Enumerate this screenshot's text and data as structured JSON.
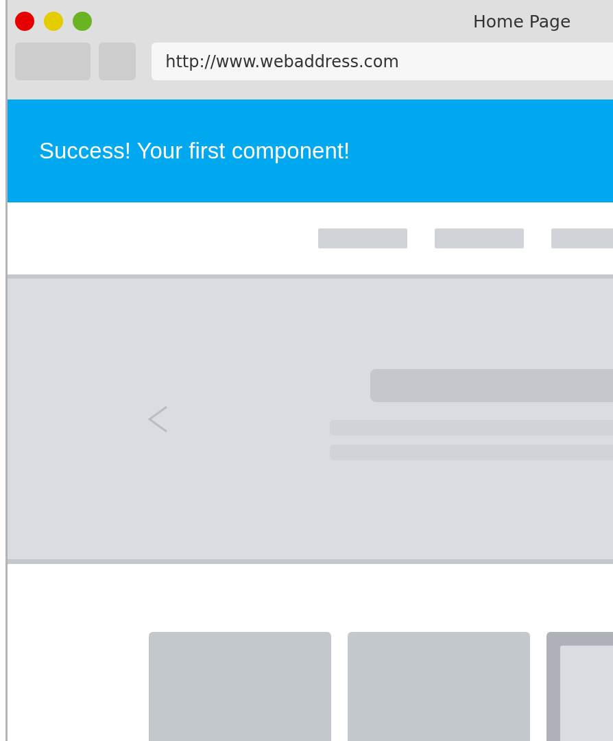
{
  "window": {
    "title": "Home Page"
  },
  "address_bar": {
    "value": "http://www.webaddress.com"
  },
  "banner": {
    "message": "Success! Your first component!"
  }
}
